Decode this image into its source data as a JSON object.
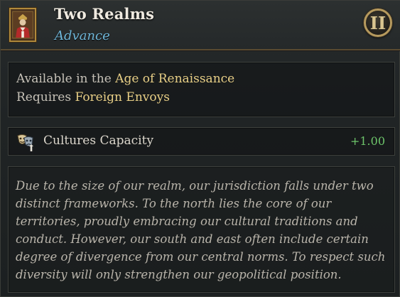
{
  "header": {
    "title": "Two Realms",
    "subtitle": "Advance",
    "age_numeral": "II",
    "portrait_icon": "royal-portrait-icon"
  },
  "requirements": {
    "available_prefix": "Available in the",
    "available_value": "Age of Renaissance",
    "requires_prefix": "Requires",
    "requires_value": "Foreign Envoys"
  },
  "modifier": {
    "icon": "theater-masks-icon",
    "label": "Cultures Capacity",
    "value": "+1.00",
    "value_color": "#6dc46a"
  },
  "description": "Due to the size of our realm, our jurisdiction falls under two distinct frameworks. To the north lies the core of our territories, proudly embracing our cultural traditions and conduct. However, our south and east often include certain degree of divergence from our central norms. To respect such diversity will only strengthen our geopolitical position.",
  "colors": {
    "title": "#efeae0",
    "subtitle": "#6fb6d8",
    "highlight": "#e8cf86",
    "frame_gold": "#b69a5e"
  }
}
